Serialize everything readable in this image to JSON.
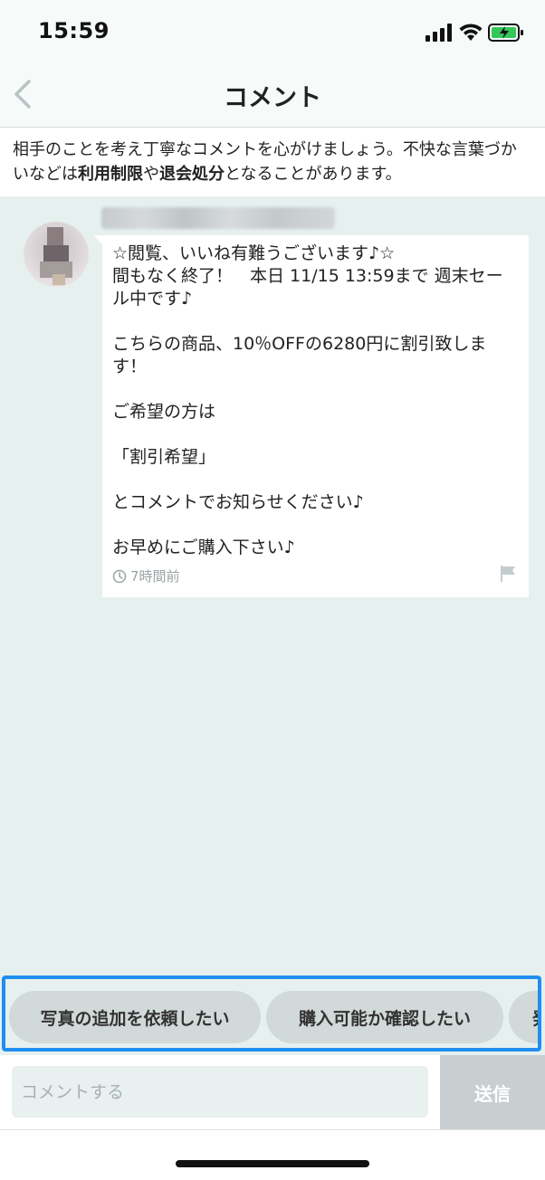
{
  "status_bar": {
    "time": "15:59"
  },
  "header": {
    "title": "コメント",
    "back_icon": "chevron-left-icon"
  },
  "notice": {
    "text_before": "相手のことを考え丁寧なコメントを心がけましょう。不快な言葉づかいなどは",
    "bold_1": "利用制限",
    "text_mid": "や",
    "bold_2": "退会処分",
    "text_after": "となることがあります。"
  },
  "comment": {
    "body": "☆閲覧、いいね有難うございます♪☆\n間もなく終了！　本日 11/15 13:59まで 週末セール中です♪\n\nこちらの商品、10％OFFの6280円に割引致します！\n\nご希望の方は\n\n「割引希望」\n\nとコメントでお知らせください♪\n\nお早めにご購入下さい♪",
    "timestamp": "7時間前",
    "clock_icon": "clock-icon",
    "flag_icon": "flag-icon"
  },
  "quick_replies": [
    {
      "label": "写真の追加を依頼したい"
    },
    {
      "label": "購入可能か確認したい"
    },
    {
      "label": "発"
    }
  ],
  "input": {
    "placeholder": "コメントする",
    "value": "",
    "send_label": "送信"
  },
  "colors": {
    "background": "#e6f0ef",
    "highlight_border": "#1f8ef1",
    "chip_bg": "#d2d9d9",
    "send_button_bg": "#c9cfd1",
    "battery_green": "#35c759"
  }
}
